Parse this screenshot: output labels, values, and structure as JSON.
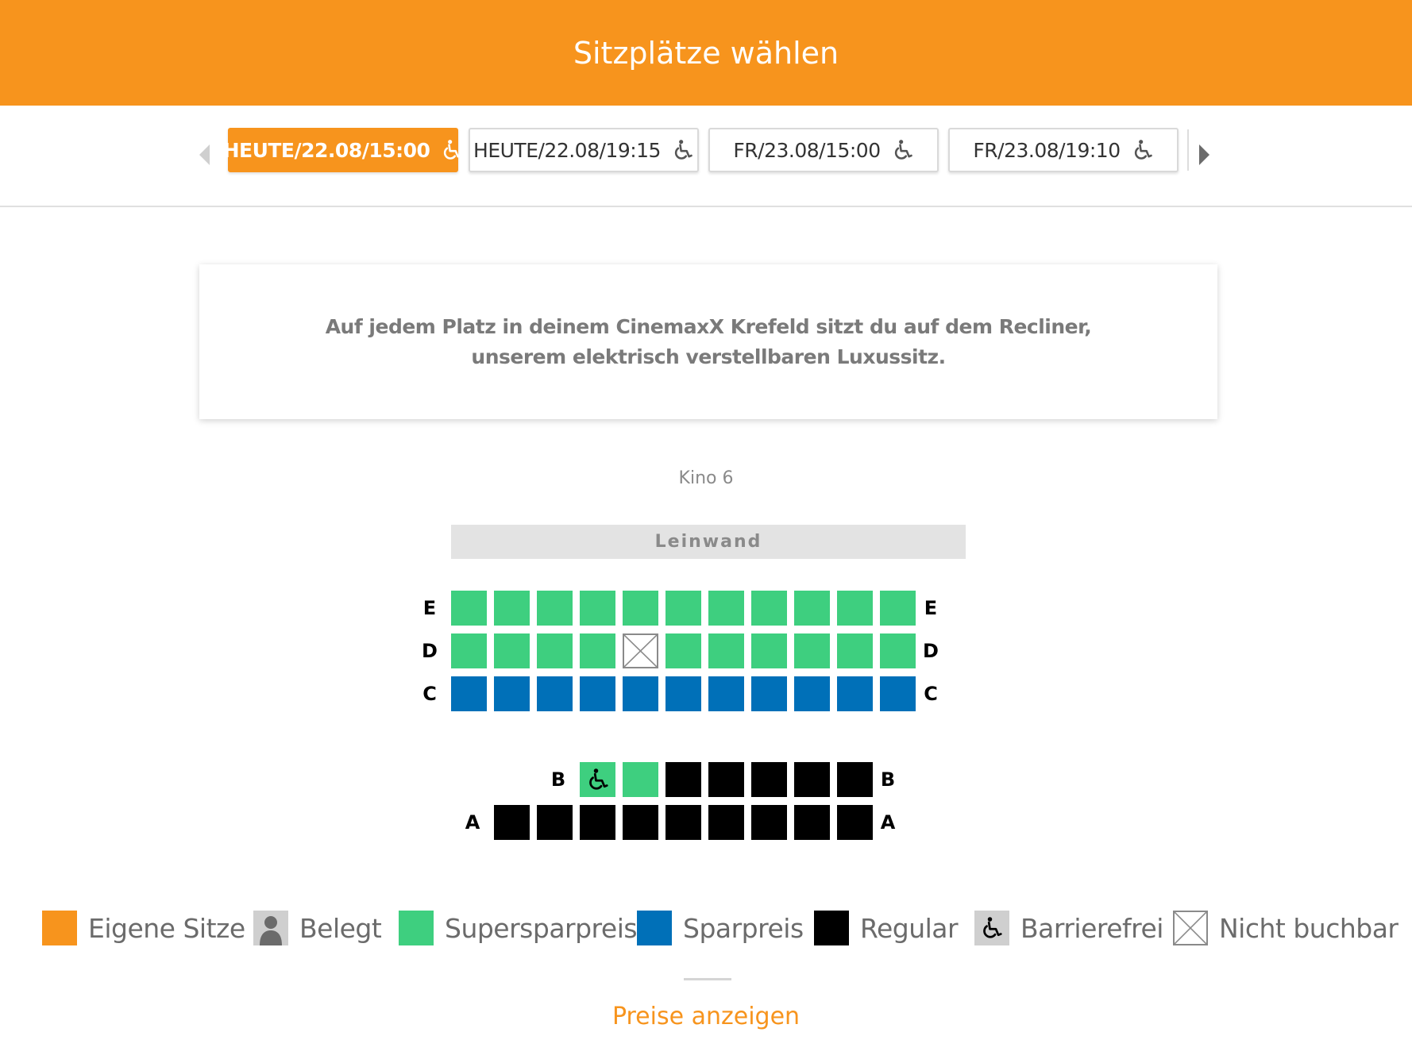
{
  "header": {
    "title": "Sitzplätze wählen"
  },
  "dates": [
    {
      "label": "HEUTE/22.08/15:00",
      "active": true,
      "icon": "wheelchair-icon"
    },
    {
      "label": "HEUTE/22.08/19:15",
      "active": false,
      "icon": "wheelchair-icon"
    },
    {
      "label": "FR/23.08/15:00",
      "active": false,
      "icon": "wheelchair-icon"
    },
    {
      "label": "FR/23.08/19:10",
      "active": false,
      "icon": "wheelchair-icon"
    }
  ],
  "info": {
    "text": "Auf jedem Platz in deinem CinemaxX Krefeld sitzt du auf dem Recliner, unserem elektrisch verstellbaren Luxussitz."
  },
  "hall": {
    "name": "Kino 6",
    "screen_label": "Leinwand"
  },
  "seatmap": {
    "rows": [
      {
        "label": "E",
        "seats": [
          "supersparpreis",
          "supersparpreis",
          "supersparpreis",
          "supersparpreis",
          "supersparpreis",
          "supersparpreis",
          "supersparpreis",
          "supersparpreis",
          "supersparpreis",
          "supersparpreis",
          "supersparpreis"
        ]
      },
      {
        "label": "D",
        "seats": [
          "supersparpreis",
          "supersparpreis",
          "supersparpreis",
          "supersparpreis",
          "nicht-buchbar",
          "supersparpreis",
          "supersparpreis",
          "supersparpreis",
          "supersparpreis",
          "supersparpreis",
          "supersparpreis"
        ]
      },
      {
        "label": "C",
        "seats": [
          "sparpreis",
          "sparpreis",
          "sparpreis",
          "sparpreis",
          "sparpreis",
          "sparpreis",
          "sparpreis",
          "sparpreis",
          "sparpreis",
          "sparpreis",
          "sparpreis"
        ]
      },
      {
        "label": "B",
        "seats": [
          null,
          null,
          null,
          "barrierefrei",
          "supersparpreis",
          "regular",
          "regular",
          "regular",
          "regular",
          "regular",
          null
        ]
      },
      {
        "label": "A",
        "seats": [
          null,
          "regular",
          "regular",
          "regular",
          "regular",
          "regular",
          "regular",
          "regular",
          "regular",
          "regular",
          null
        ]
      }
    ]
  },
  "legend": [
    {
      "key": "eigene-sitze",
      "label": "Eigene Sitze",
      "color": "#f7941d"
    },
    {
      "key": "belegt",
      "label": "Belegt",
      "color": "#cfcfcf"
    },
    {
      "key": "supersparpreis",
      "label": "Supersparpreis",
      "color": "#3ecf7f"
    },
    {
      "key": "sparpreis",
      "label": "Sparpreis",
      "color": "#0070b8"
    },
    {
      "key": "regular",
      "label": "Regular",
      "color": "#000000"
    },
    {
      "key": "barrierefrei",
      "label": "Barrierefrei",
      "color": "#cfcfcf"
    },
    {
      "key": "nicht-buchbar",
      "label": "Nicht buchbar",
      "color": "#ffffff"
    }
  ],
  "footer": {
    "prices_link": "Preise anzeigen"
  },
  "colors": {
    "brand": "#f7941d",
    "supersparpreis": "#3ecf7f",
    "sparpreis": "#0070b8",
    "regular": "#000000"
  }
}
